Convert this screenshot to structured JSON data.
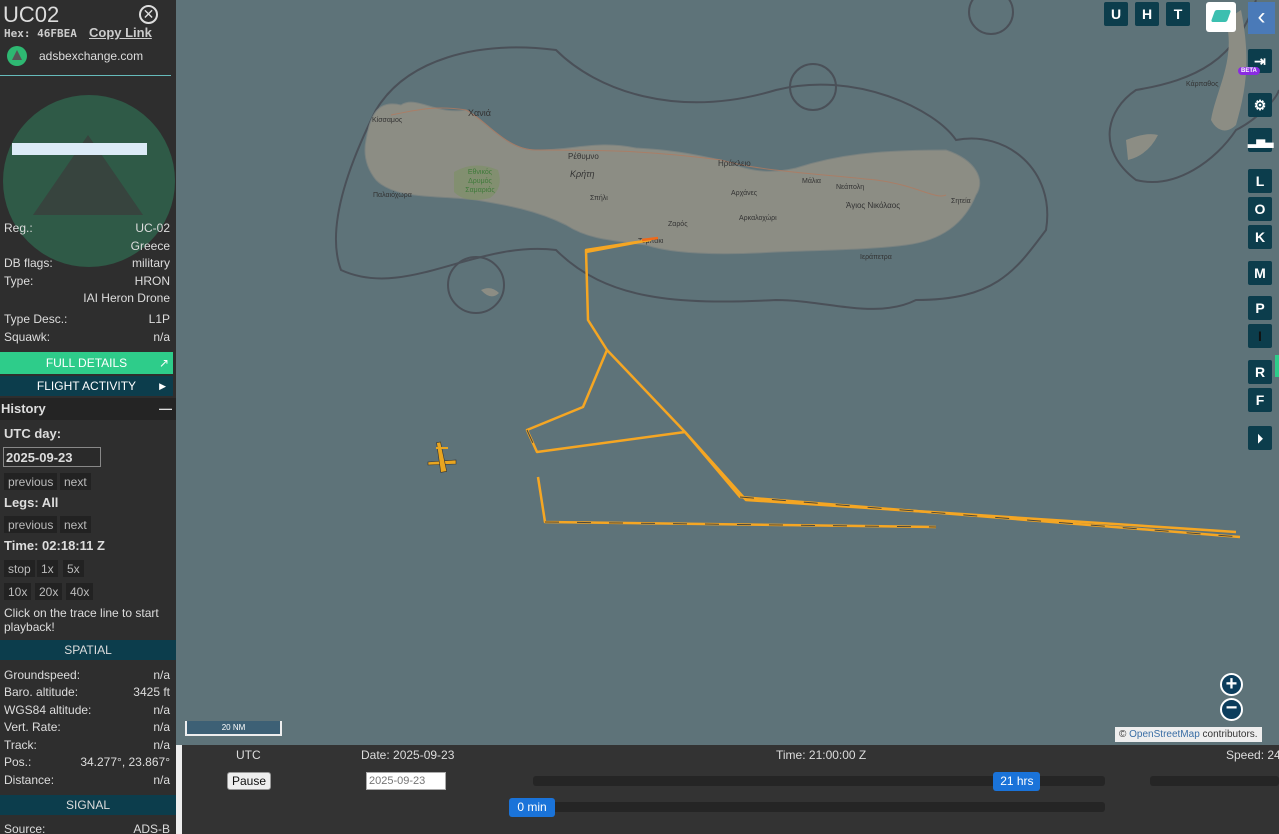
{
  "aircraft": {
    "callsign": "UC02",
    "hex_label": "Hex:",
    "hex": "46FBEA",
    "copy_link": "Copy Link",
    "source_site": "adsbexchange.com"
  },
  "info": [
    {
      "label": "Reg.:",
      "value": "UC-02"
    },
    {
      "label": "",
      "value": "Greece"
    },
    {
      "label": "DB flags:",
      "value": "military"
    },
    {
      "label": "Type:",
      "value": "HRON"
    },
    {
      "label": "",
      "value": "IAI Heron Drone"
    },
    {
      "label": "Type Desc.:",
      "value": "L1P"
    },
    {
      "label": "Squawk:",
      "value": "n/a"
    }
  ],
  "buttons": {
    "full_details": "FULL DETAILS",
    "flight_activity": "FLIGHT ACTIVITY"
  },
  "history": {
    "title": "History",
    "collapse": "—",
    "utc_day_label": "UTC day:",
    "utc_day": "2025-09-23",
    "previous": "previous",
    "next": "next",
    "legs": "Legs: All",
    "time": "Time: 02:18:11 Z",
    "speeds": [
      "stop",
      "1x",
      "5x",
      "10x",
      "20x",
      "40x"
    ],
    "hint": "Click on the trace line to start playback!"
  },
  "spatial": {
    "title": "SPATIAL",
    "rows": [
      {
        "label": "Groundspeed:",
        "value": "n/a"
      },
      {
        "label": "Baro. altitude:",
        "value": "3425 ft"
      },
      {
        "label": "WGS84 altitude:",
        "value": "n/a"
      },
      {
        "label": "Vert. Rate:",
        "value": "n/a"
      },
      {
        "label": "Track:",
        "value": "n/a"
      },
      {
        "label": "Pos.:",
        "value": "34.277°, 23.867°"
      },
      {
        "label": "Distance:",
        "value": "n/a"
      }
    ]
  },
  "signal": {
    "title": "SIGNAL",
    "rows": [
      {
        "label": "Source:",
        "value": "ADS-B"
      }
    ]
  },
  "map": {
    "top_buttons": [
      "U",
      "H",
      "T"
    ],
    "right_buttons": [
      "L",
      "O",
      "K",
      "M",
      "P",
      "I",
      "R",
      "F"
    ],
    "beta": "BETA",
    "scale": "20 NM",
    "attribution_prefix": "©",
    "attribution_link": "OpenStreetMap",
    "attribution_suffix": "contributors.",
    "trace_color": "#f5a623",
    "labels": [
      "Κίσσαμος",
      "Χανιά",
      "Ρέθυμνο",
      "Κρήτη",
      "Ηράκλειο",
      "Παλαιόχωρα",
      "Σπήλι",
      "Ζαρός",
      "Αρχάνες",
      "Αρκαλοχώρι",
      "Μάλια",
      "Νεάπολη",
      "Άγιος Νικόλαος",
      "Σητεία",
      "Ιεράπετρα",
      "Τυμπάκι",
      "Κάρπαθος",
      "Εθνικός Δρυμός Σαμαριάς"
    ]
  },
  "replay": {
    "utc": "UTC",
    "date": "Date: 2025-09-23",
    "time": "Time: 21:00:00 Z",
    "speed": "Speed: 24",
    "pause": "Pause",
    "date_placeholder": "2025-09-23",
    "hours_value": "21 hrs",
    "hours_fraction": 0.875,
    "min_value": "0 min",
    "min_fraction": 0
  }
}
